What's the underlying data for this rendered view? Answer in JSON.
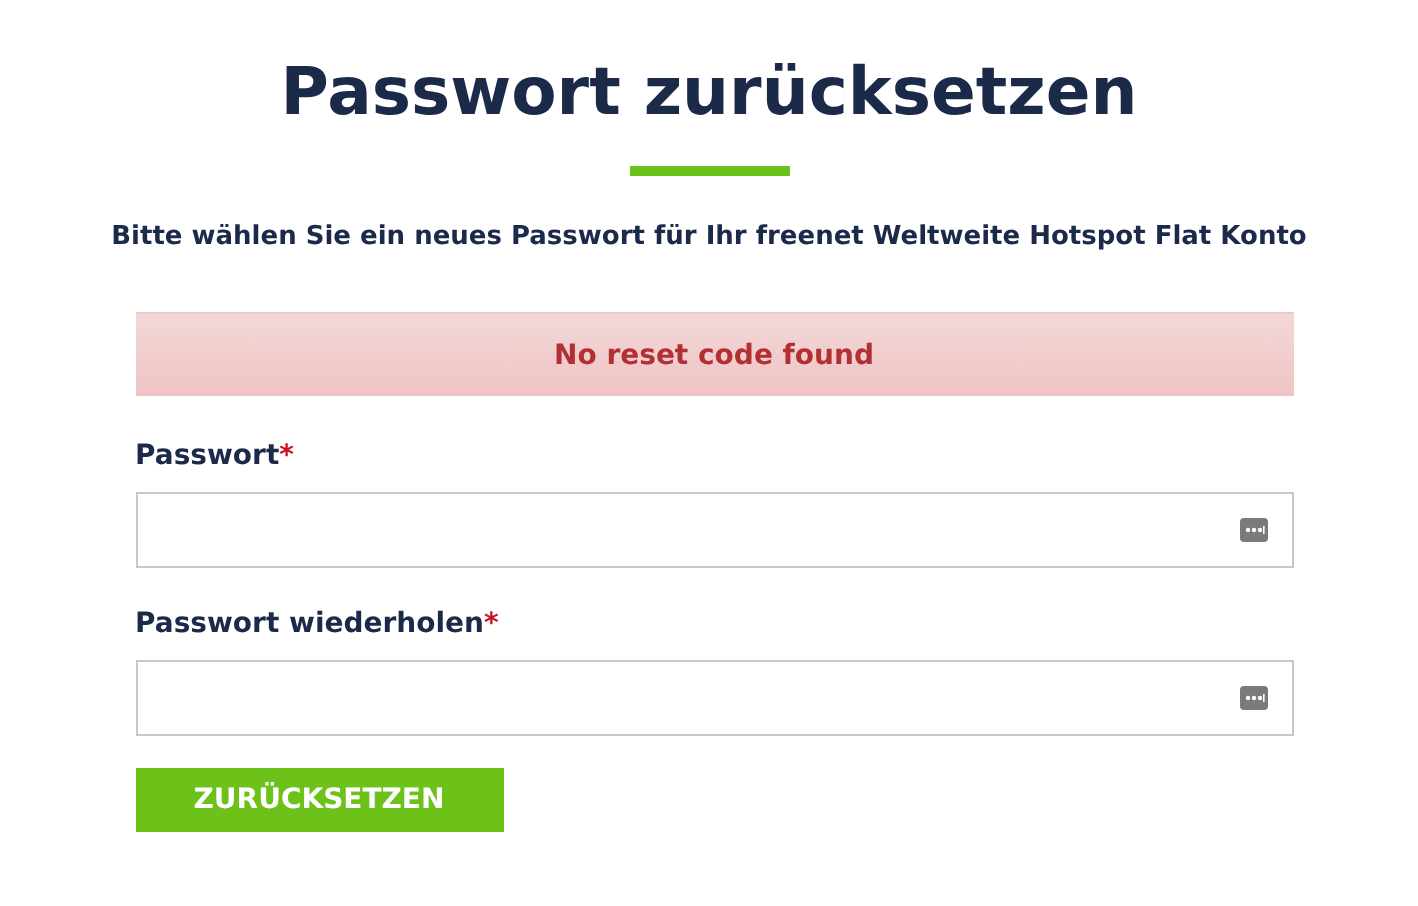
{
  "title": "Passwort zurücksetzen",
  "subtitle": "Bitte wählen Sie ein neues Passwort für Ihr freenet Weltweite Hotspot Flat Konto",
  "alert": {
    "text": "No reset code found"
  },
  "fields": [
    {
      "label": "Passwort",
      "required_mark": "*"
    },
    {
      "label": "Passwort wiederholen",
      "required_mark": "*"
    }
  ],
  "submit_button": "ZURÜCKSETZEN"
}
